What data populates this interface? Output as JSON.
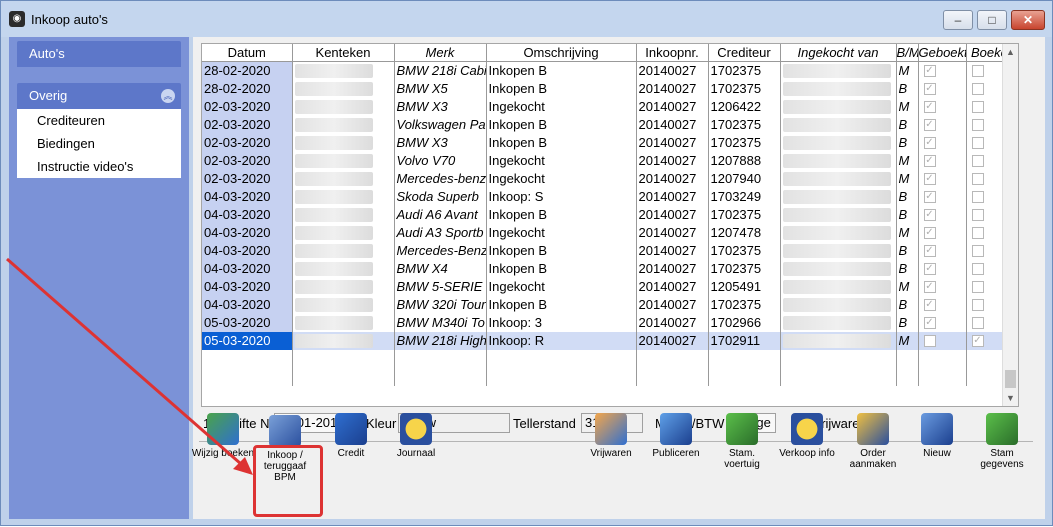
{
  "window": {
    "title": "Inkoop auto's",
    "controls": {
      "minimize": "‒",
      "maximize": "□",
      "close": "✕"
    }
  },
  "sidebar": {
    "top_item": "Auto's",
    "group": "Overig",
    "items": [
      "Crediteuren",
      "Biedingen",
      "Instructie video's"
    ]
  },
  "grid": {
    "columns": [
      "Datum",
      "Kenteken",
      "Merk",
      "Omschrijving",
      "Inkoopnr.",
      "Crediteur",
      "Ingekocht van",
      "B/M",
      "Geboekt",
      "Boeken"
    ],
    "rows": [
      {
        "datum": "28-02-2020",
        "merk": "BMW 218i Cabi",
        "oms": "Inkopen B",
        "inkoopnr": "20140027",
        "crediteur": "1702375",
        "bm": "M",
        "geboekt": true,
        "boeken": false
      },
      {
        "datum": "28-02-2020",
        "merk": "BMW X5",
        "oms": "Inkopen B",
        "inkoopnr": "20140027",
        "crediteur": "1702375",
        "bm": "B",
        "geboekt": true,
        "boeken": false
      },
      {
        "datum": "02-03-2020",
        "merk": "BMW X3",
        "oms": "Ingekocht",
        "inkoopnr": "20140027",
        "crediteur": "1206422",
        "bm": "M",
        "geboekt": true,
        "boeken": false
      },
      {
        "datum": "02-03-2020",
        "merk": "Volkswagen Pa",
        "oms": "Inkopen B",
        "inkoopnr": "20140027",
        "crediteur": "1702375",
        "bm": "B",
        "geboekt": true,
        "boeken": false
      },
      {
        "datum": "02-03-2020",
        "merk": "BMW X3",
        "oms": "Inkopen B",
        "inkoopnr": "20140027",
        "crediteur": "1702375",
        "bm": "B",
        "geboekt": true,
        "boeken": false
      },
      {
        "datum": "02-03-2020",
        "merk": "Volvo V70",
        "oms": "Ingekocht",
        "inkoopnr": "20140027",
        "crediteur": "1207888",
        "bm": "M",
        "geboekt": true,
        "boeken": false
      },
      {
        "datum": "02-03-2020",
        "merk": "Mercedes-benz",
        "oms": "Ingekocht",
        "inkoopnr": "20140027",
        "crediteur": "1207940",
        "bm": "M",
        "geboekt": true,
        "boeken": false
      },
      {
        "datum": "04-03-2020",
        "merk": "Skoda Superb",
        "oms": "Inkoop: S",
        "inkoopnr": "20140027",
        "crediteur": "1703249",
        "bm": "B",
        "geboekt": true,
        "boeken": false
      },
      {
        "datum": "04-03-2020",
        "merk": "Audi A6 Avant",
        "oms": "Inkopen B",
        "inkoopnr": "20140027",
        "crediteur": "1702375",
        "bm": "B",
        "geboekt": true,
        "boeken": false
      },
      {
        "datum": "04-03-2020",
        "merk": "Audi A3 Sportb",
        "oms": "Ingekocht",
        "inkoopnr": "20140027",
        "crediteur": "1207478",
        "bm": "M",
        "geboekt": true,
        "boeken": false
      },
      {
        "datum": "04-03-2020",
        "merk": "Mercedes-Benz",
        "oms": "Inkopen B",
        "inkoopnr": "20140027",
        "crediteur": "1702375",
        "bm": "B",
        "geboekt": true,
        "boeken": false
      },
      {
        "datum": "04-03-2020",
        "merk": "BMW X4",
        "oms": "Inkopen B",
        "inkoopnr": "20140027",
        "crediteur": "1702375",
        "bm": "B",
        "geboekt": true,
        "boeken": false
      },
      {
        "datum": "04-03-2020",
        "merk": "BMW 5-SERIE",
        "oms": "Ingekocht",
        "inkoopnr": "20140027",
        "crediteur": "1205491",
        "bm": "M",
        "geboekt": true,
        "boeken": false
      },
      {
        "datum": "04-03-2020",
        "merk": "BMW 320i Tour",
        "oms": "Inkopen B",
        "inkoopnr": "20140027",
        "crediteur": "1702375",
        "bm": "B",
        "geboekt": true,
        "boeken": false
      },
      {
        "datum": "05-03-2020",
        "merk": "BMW M340i To",
        "oms": "Inkoop: 3",
        "inkoopnr": "20140027",
        "crediteur": "1702966",
        "bm": "B",
        "geboekt": true,
        "boeken": false
      },
      {
        "datum": "05-03-2020",
        "merk": "BMW 218i High",
        "oms": "Inkoop: R",
        "inkoopnr": "20140027",
        "crediteur": "1702911",
        "bm": "M",
        "geboekt": false,
        "boeken": true,
        "selected": true
      }
    ]
  },
  "details": {
    "afgifte_label": "1e afgifte NL",
    "afgifte_value": "09-01-2018",
    "kleur_label": "Kleur",
    "kleur_value": "blauw",
    "teller_label": "Tellerstand",
    "teller_value": "31879",
    "marge_label": "Marge/BTW",
    "marge_value": "Marge",
    "vrijwaren_label": "Vrijwaren"
  },
  "toolbar": {
    "wijzig": "Wijzig boeken",
    "inkoop": "Inkoop / teruggaaf BPM",
    "credit": "Credit",
    "journaal": "Journaal",
    "vrijwaren": "Vrijwaren",
    "publiceren": "Publiceren",
    "stam_voertuig": "Stam. voertuig",
    "verkoop_info": "Verkoop info",
    "order": "Order aanmaken",
    "nieuw": "Nieuw",
    "stam_gegevens": "Stam gegevens"
  },
  "colors": {
    "accent": "#0a5fd4",
    "sidebar": "#7b92d7",
    "highlight": "#dd3333"
  }
}
